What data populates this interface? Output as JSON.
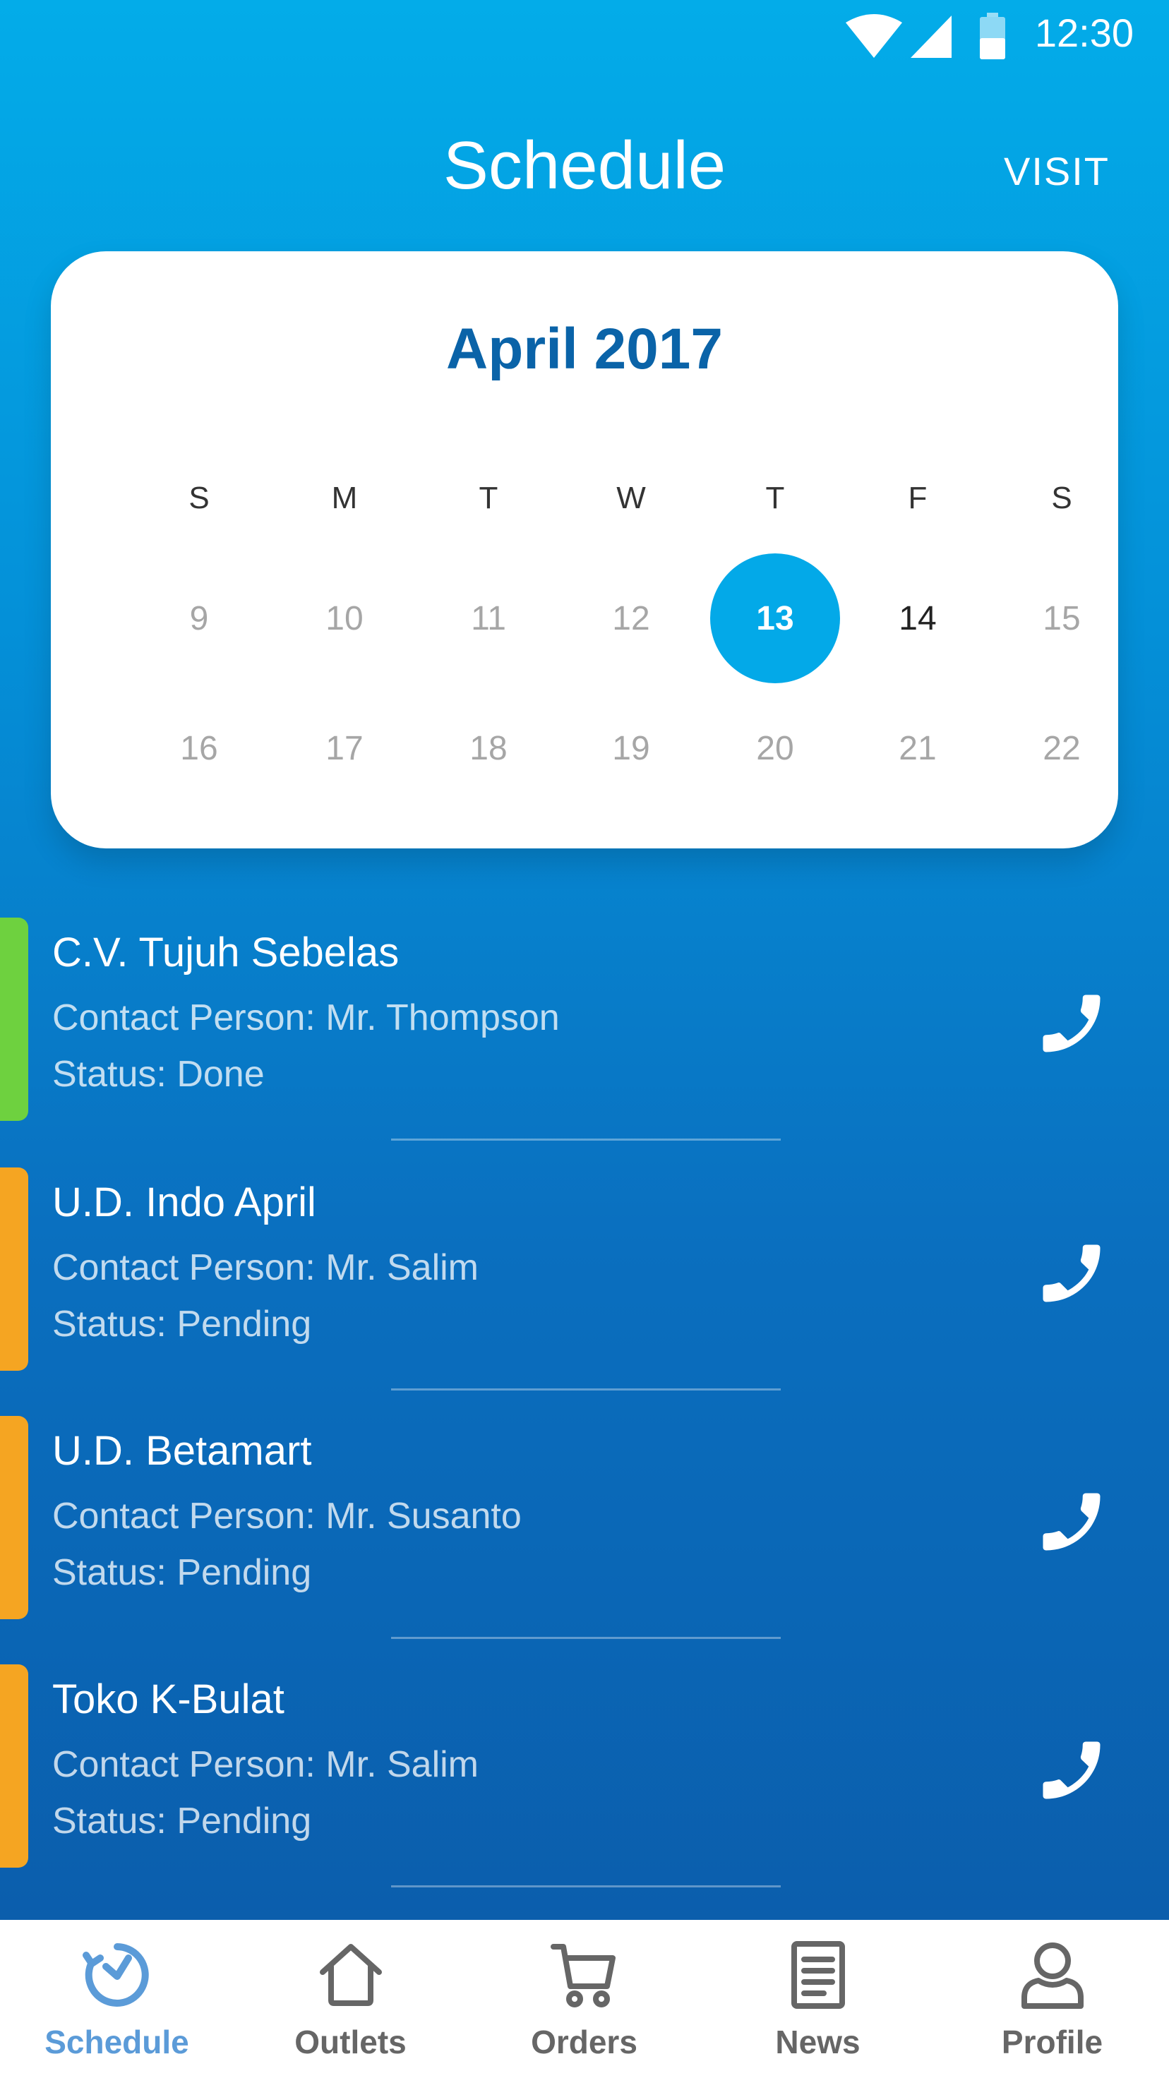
{
  "status_bar": {
    "time": "12:30",
    "icons": [
      "wifi-icon",
      "cell-signal-icon",
      "battery-icon"
    ]
  },
  "header": {
    "title": "Schedule",
    "action_label": "VISIT"
  },
  "calendar": {
    "month_label": "April 2017",
    "weekdays": [
      "S",
      "M",
      "T",
      "W",
      "T",
      "F",
      "S"
    ],
    "weeks": [
      [
        "9",
        "10",
        "11",
        "12",
        "13",
        "14",
        "15"
      ],
      [
        "16",
        "17",
        "18",
        "19",
        "20",
        "21",
        "22"
      ]
    ],
    "selected_day": "13",
    "colors": {
      "accent": "#03a9e8",
      "month": "#0a63a8"
    }
  },
  "visits": [
    {
      "name": "C.V. Tujuh Sebelas",
      "contact": "Contact Person: Mr. Thompson",
      "status": "Status: Done",
      "status_color": "#6ed13f"
    },
    {
      "name": "U.D. Indo April",
      "contact": "Contact Person: Mr. Salim",
      "status": "Status: Pending",
      "status_color": "#f5a522"
    },
    {
      "name": "U.D. Betamart",
      "contact": "Contact Person: Mr. Susanto",
      "status": "Status: Pending",
      "status_color": "#f5a522"
    },
    {
      "name": "Toko K-Bulat",
      "contact": "Contact Person: Mr. Salim",
      "status": "Status: Pending",
      "status_color": "#f5a522"
    }
  ],
  "bottom_nav": {
    "items": [
      {
        "label": "Schedule",
        "icon": "clock-icon",
        "active": true
      },
      {
        "label": "Outlets",
        "icon": "home-icon",
        "active": false
      },
      {
        "label": "Orders",
        "icon": "cart-icon",
        "active": false
      },
      {
        "label": "News",
        "icon": "document-icon",
        "active": false
      },
      {
        "label": "Profile",
        "icon": "person-icon",
        "active": false
      }
    ],
    "active_color": "#5b9bd8",
    "inactive_color": "#666666"
  }
}
